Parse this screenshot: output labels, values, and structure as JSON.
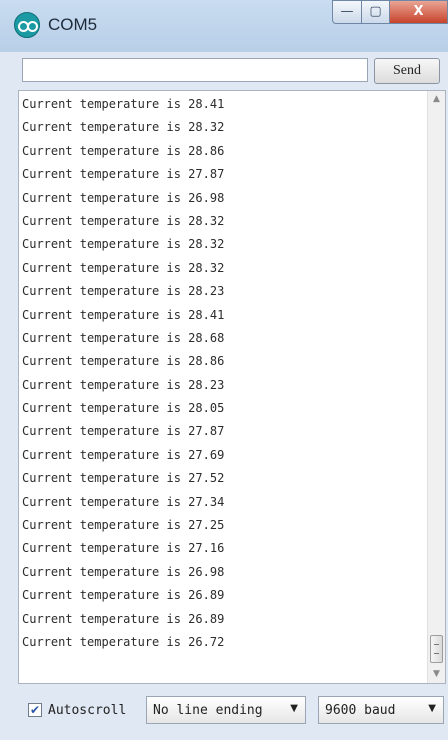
{
  "window": {
    "title": "COM5",
    "min_glyph": "—",
    "max_glyph": "▢",
    "close_glyph": "X"
  },
  "toprow": {
    "input_value": "",
    "send_label": "Send"
  },
  "console": {
    "lines": [
      "Current temperature is 28.41",
      "Current temperature is 28.32",
      "Current temperature is 28.86",
      "Current temperature is 27.87",
      "Current temperature is 26.98",
      "Current temperature is 28.32",
      "Current temperature is 28.32",
      "Current temperature is 28.32",
      "Current temperature is 28.23",
      "Current temperature is 28.41",
      "Current temperature is 28.68",
      "Current temperature is 28.86",
      "Current temperature is 28.23",
      "Current temperature is 28.05",
      "Current temperature is 27.87",
      "Current temperature is 27.69",
      "Current temperature is 27.52",
      "Current temperature is 27.34",
      "Current temperature is 27.25",
      "Current temperature is 27.16",
      "Current temperature is 26.98",
      "Current temperature is 26.89",
      "Current temperature is 26.89",
      "Current temperature is 26.72"
    ]
  },
  "statusbar": {
    "autoscroll_checked": true,
    "autoscroll_label": "Autoscroll",
    "line_ending": "No line ending",
    "baud": "9600 baud"
  },
  "colors": {
    "app_icon": "#1c9aa3",
    "close_button": "#c8432b"
  }
}
